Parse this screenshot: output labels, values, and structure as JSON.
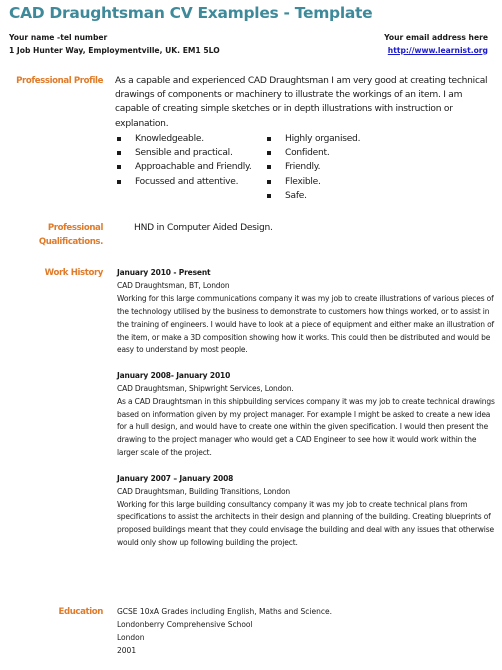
{
  "document": {
    "title": "CAD Draughtsman CV Examples - Template",
    "header": {
      "name_line": "Your name -tel number",
      "address_line": "1 Job Hunter Way, Employmentville, UK. EM1 5LO",
      "email_line": "Your email address here",
      "website_link": "http://www.learnist.org"
    },
    "colors": {
      "title": "#3f8a9a",
      "section_label": "#e07b2a",
      "link": "#1a1acc"
    },
    "profile": {
      "label": "Professional Profile",
      "text": "As a capable and experienced CAD Draughtsman I am very good at creating technical drawings of components or machinery to illustrate the workings of an item. I am capable of creating simple sketches or in depth illustrations with instruction or explanation.",
      "bullets_left": [
        "Knowledgeable.",
        "Sensible and practical.",
        "Approachable and Friendly.",
        "Focussed and attentive."
      ],
      "bullets_right": [
        "Highly organised.",
        "Confident.",
        "Friendly.",
        "Flexible.",
        "Safe."
      ]
    },
    "qualifications": {
      "label_line1": "Professional",
      "label_line2": "Qualifications.",
      "text": "HND in Computer Aided Design."
    },
    "work_history": {
      "label": "Work History",
      "jobs": [
        {
          "dates": "January 2010 - Present",
          "role": "CAD Draughtsman, BT, London",
          "description": "Working for this large communications company it was my job to create illustrations of various pieces of the technology utilised by the business to demonstrate to customers how things worked, or to assist in the training of engineers. I would have to look at a piece of equipment and either make an illustration of the item, or make a 3D composition showing how it works. This could then be distributed and would be easy to understand by most people."
        },
        {
          "dates": "January 2008- January 2010",
          "role": "CAD Draughtsman, Shipwright Services, London.",
          "description": "As a CAD Draughtsman in this shipbuilding services company it was my job to create technical drawings based on information given by my project manager. For example I might be asked to create a new idea for a hull design, and would have to create one within the given specification. I would then present the drawing to the project manager who would get a CAD Engineer to see how it would work within the larger scale of the project."
        },
        {
          "dates": "January 2007 – January 2008",
          "role": "CAD Draughtsman, Building Transitions, London",
          "description": "Working for this large building consultancy company it was my job to create technical plans from specifications to assist the architects in their design and planning of the building. Creating blueprints of proposed buildings meant that they could envisage the building and deal with any issues that otherwise would only show up following building the project."
        }
      ]
    },
    "education": {
      "label": "Education",
      "lines": [
        "GCSE 10xA Grades including English, Maths and Science.",
        "Londonberry Comprehensive School",
        "London",
        "2001"
      ]
    }
  }
}
